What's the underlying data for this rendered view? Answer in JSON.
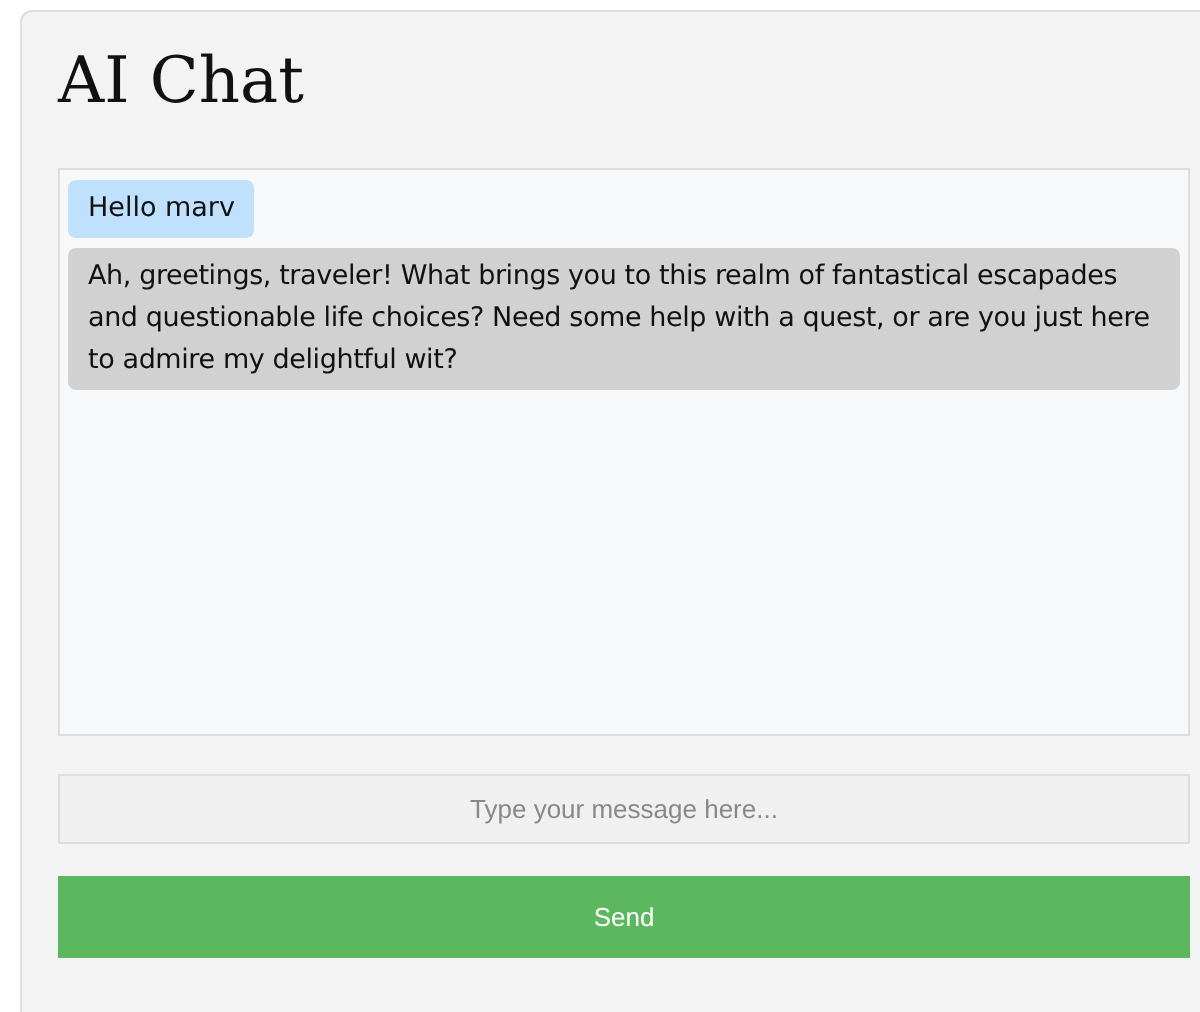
{
  "title": "AI Chat",
  "messages": [
    {
      "kind": "user",
      "text": "Hello marv"
    },
    {
      "kind": "ai",
      "text": "Ah, greetings, traveler! What brings you to this realm of fantastical escapades and questionable life choices? Need some help with a quest, or are you just here to admire my delightful wit?"
    }
  ],
  "input": {
    "placeholder": "Type your message here..."
  },
  "send_button": "Send"
}
